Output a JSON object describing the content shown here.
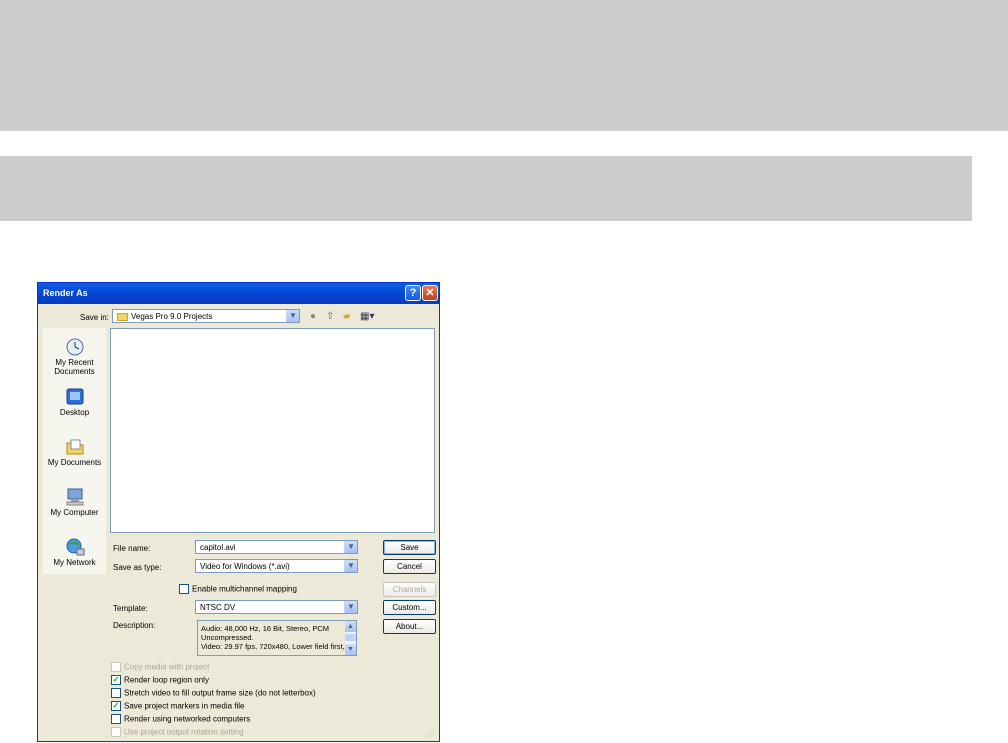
{
  "dialog": {
    "title": "Render As",
    "help_glyph": "?",
    "close_glyph": "✕"
  },
  "save_in": {
    "label": "Save in:",
    "value": "Vegas Pro 9.0 Projects"
  },
  "places": [
    {
      "icon": "my-recent-documents-icon",
      "label_line1": "My Recent",
      "label_line2": "Documents"
    },
    {
      "icon": "desktop-icon",
      "label_line1": "Desktop",
      "label_line2": ""
    },
    {
      "icon": "my-documents-icon",
      "label_line1": "My Documents",
      "label_line2": ""
    },
    {
      "icon": "my-computer-icon",
      "label_line1": "My Computer",
      "label_line2": ""
    },
    {
      "icon": "my-network-icon",
      "label_line1": "My Network",
      "label_line2": ""
    }
  ],
  "fields": {
    "file_name_label": "File name:",
    "file_name_value": "capitol.avi",
    "save_type_label": "Save as type:",
    "save_type_value": "Video for Windows (*.avi)",
    "multichannel_label": "Enable multichannel mapping",
    "template_label": "Template:",
    "template_value": "NTSC DV",
    "description_label": "Description:",
    "description_lines": [
      "Audio: 48,000 Hz, 16 Bit, Stereo, PCM",
      "Uncompressed.",
      "Video: 29.97 fps, 720x480, Lower field first,"
    ]
  },
  "buttons": {
    "save": "Save",
    "cancel": "Cancel",
    "channels": "Channels",
    "custom": "Custom...",
    "about": "About..."
  },
  "options": [
    {
      "label": "Copy media with project",
      "checked": false,
      "disabled": true
    },
    {
      "label": "Render loop region only",
      "checked": true,
      "disabled": false
    },
    {
      "label": "Stretch video to fill output frame size (do not letterbox)",
      "checked": false,
      "disabled": false
    },
    {
      "label": "Save project markers in media file",
      "checked": true,
      "disabled": false
    },
    {
      "label": "Render using networked computers",
      "checked": false,
      "disabled": false
    },
    {
      "label": "Use project output rotation setting",
      "checked": false,
      "disabled": true
    }
  ],
  "colors": {
    "title_bar": "#0348d6",
    "dialog_bg": "#ece9d8",
    "check_green": "#21a121"
  }
}
